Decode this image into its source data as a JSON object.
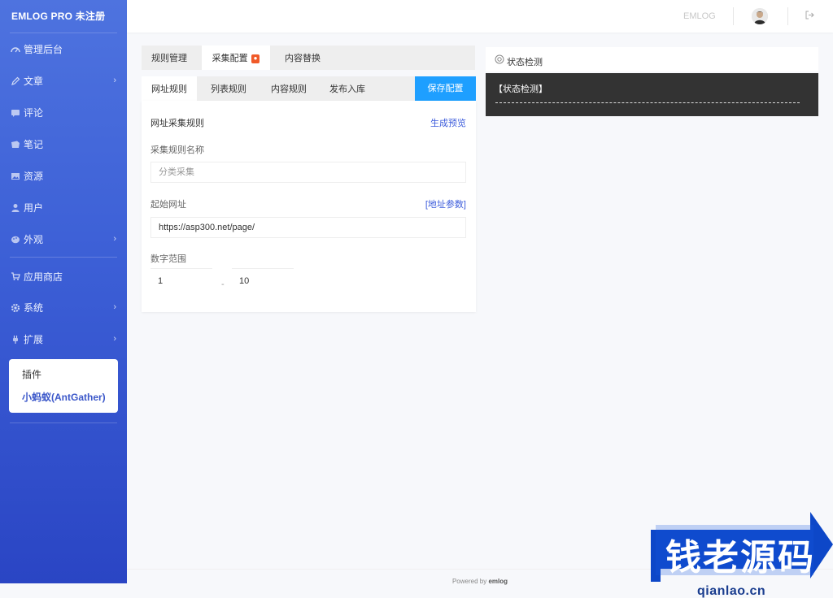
{
  "sidebar": {
    "brand": "EMLOG PRO 未注册",
    "items": [
      {
        "label": "管理后台",
        "icon": "dashboard-icon",
        "has_arrow": false
      },
      {
        "label": "文章",
        "icon": "pencil-icon",
        "has_arrow": true
      },
      {
        "label": "评论",
        "icon": "comment-icon",
        "has_arrow": false
      },
      {
        "label": "笔记",
        "icon": "note-icon",
        "has_arrow": false
      },
      {
        "label": "资源",
        "icon": "image-icon",
        "has_arrow": false
      },
      {
        "label": "用户",
        "icon": "user-icon",
        "has_arrow": false
      },
      {
        "label": "外观",
        "icon": "palette-icon",
        "has_arrow": true
      },
      {
        "label": "应用商店",
        "icon": "cart-icon",
        "has_arrow": false
      },
      {
        "label": "系统",
        "icon": "gear-icon",
        "has_arrow": true
      },
      {
        "label": "扩展",
        "icon": "plug-icon",
        "has_arrow": true
      }
    ],
    "submenu": {
      "item1": "插件",
      "item2": "小蚂蚁(AntGather)"
    }
  },
  "topbar": {
    "site_name": "EMLOG",
    "avatar_icon": "avatar-icon",
    "logout_icon": "logout-icon"
  },
  "tabs_main": [
    {
      "label": "规则管理",
      "active": false
    },
    {
      "label": "采集配置",
      "active": true,
      "badge": "●"
    },
    {
      "label": "内容替换",
      "active": false
    }
  ],
  "tabs_sub": [
    {
      "label": "网址规则",
      "active": true
    },
    {
      "label": "列表规则",
      "active": false
    },
    {
      "label": "内容规则",
      "active": false
    },
    {
      "label": "发布入库",
      "active": false
    }
  ],
  "save_button": "保存配置",
  "form": {
    "title": "网址采集规则",
    "preview_link": "生成预览",
    "rule_name_label": "采集规则名称",
    "rule_name_placeholder": "分类采集",
    "start_url_label": "起始网址",
    "start_url_link": "[地址参数]",
    "start_url_value": "https://asp300.net/page/",
    "range_label": "数字范围",
    "range_from": "1",
    "range_sep": "-",
    "range_to": "10"
  },
  "status": {
    "title": "状态检测",
    "body_label": "【状态检测】"
  },
  "footer": {
    "prefix": "Powered by",
    "brand": "emlog"
  },
  "watermark": {
    "text": "钱老源码",
    "url": "qianlao.cn"
  },
  "colors": {
    "sidebar_top": "#4e73df",
    "sidebar_bottom": "#2a45c4",
    "primary_button": "#1e9fff",
    "badge": "#f05a29",
    "link": "#3b5bdb",
    "status_bg": "#333333"
  }
}
